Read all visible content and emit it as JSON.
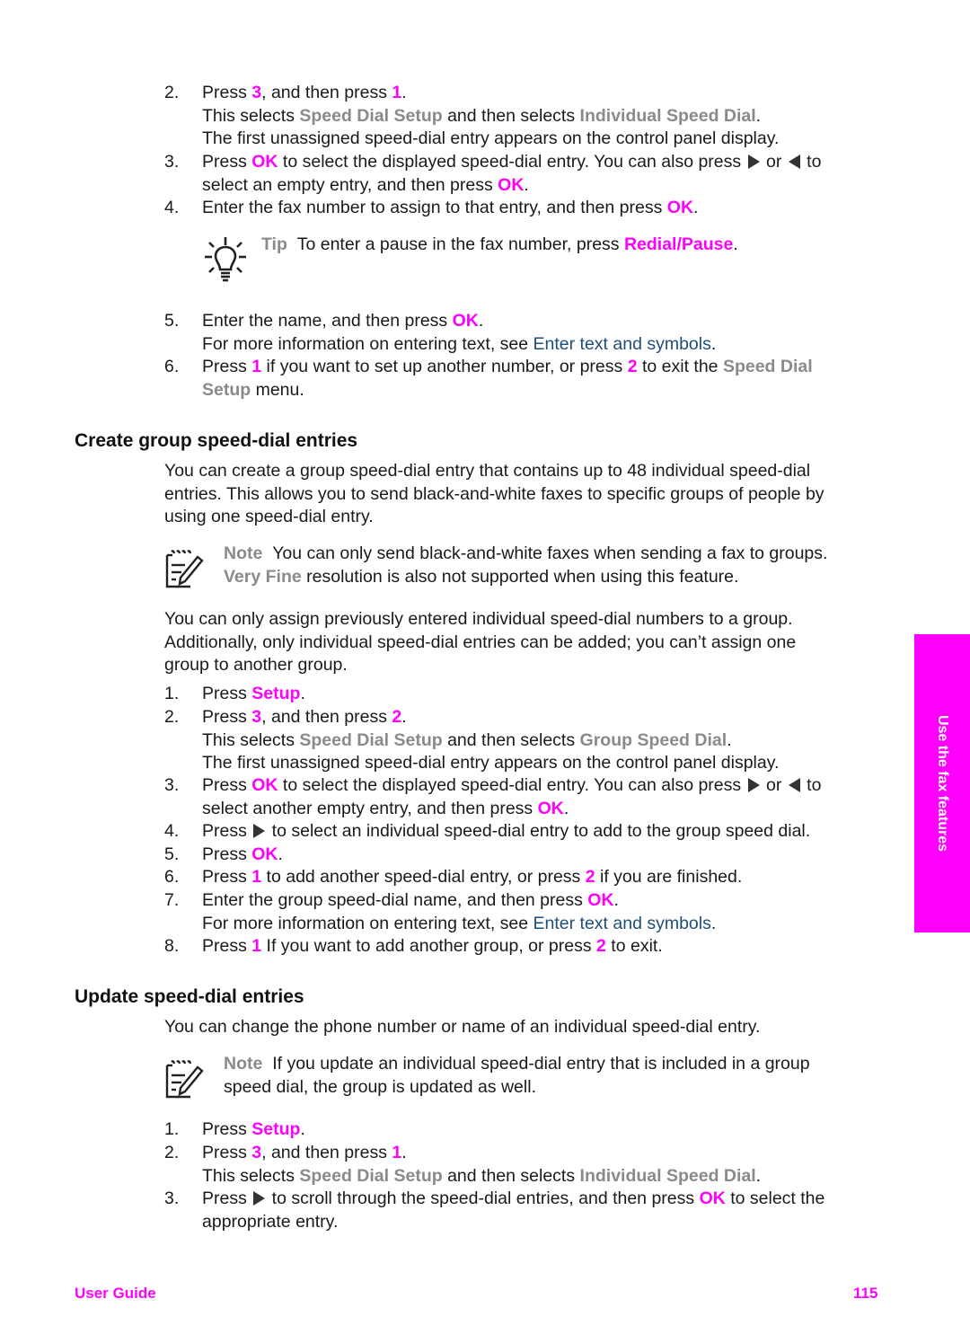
{
  "section1_steps": {
    "s2": {
      "num": "2.",
      "t1": "Press ",
      "k1": "3",
      "t2": ", and then press ",
      "k2": "1",
      "t3": ".",
      "l2a": "This selects ",
      "m1": "Speed Dial Setup",
      "l2b": " and then selects ",
      "m2": "Individual Speed Dial",
      "l2c": ".",
      "l3": "The first unassigned speed-dial entry appears on the control panel display."
    },
    "s3": {
      "num": "3.",
      "t1": "Press ",
      "k1": "OK",
      "t2": " to select the displayed speed-dial entry. You can also press ",
      "t3": " or ",
      "t4": " to",
      "l2a": "select an empty entry, and then press ",
      "k2": "OK",
      "l2b": "."
    },
    "s4": {
      "num": "4.",
      "t1": "Enter the fax number to assign to that entry, and then press ",
      "k1": "OK",
      "t2": "."
    },
    "tip": {
      "label": "Tip",
      "text": "To enter a pause in the fax number, press ",
      "key": "Redial/Pause",
      "end": "."
    },
    "s5": {
      "num": "5.",
      "t1": "Enter the name, and then press ",
      "k1": "OK",
      "t2": ".",
      "l2a": "For more information on entering text, see ",
      "link": "Enter text and symbols",
      "l2b": "."
    },
    "s6": {
      "num": "6.",
      "t1": "Press ",
      "k1": "1",
      "t2": " if you want to set up another number, or press ",
      "k2": "2",
      "t3": " to exit the ",
      "m1": "Speed Dial",
      "m2": "Setup",
      "l2b": " menu."
    }
  },
  "section2": {
    "heading": "Create group speed-dial entries",
    "intro": [
      "You can create a group speed-dial entry that contains up to 48 individual speed-dial",
      "entries. This allows you to send black-and-white faxes to specific groups of people by",
      "using one speed-dial entry."
    ],
    "note": {
      "label": "Note",
      "l1": "You can only send black-and-white faxes when sending a fax to groups.",
      "m1": "Very Fine",
      "l2": " resolution is also not supported when using this feature."
    },
    "para2": [
      "You can only assign previously entered individual speed-dial numbers to a group.",
      "Additionally, only individual speed-dial entries can be added; you can’t assign one",
      "group to another group."
    ],
    "s1": {
      "num": "1.",
      "t1": "Press ",
      "k1": "Setup",
      "t2": "."
    },
    "s2": {
      "num": "2.",
      "t1": "Press ",
      "k1": "3",
      "t2": ", and then press ",
      "k2": "2",
      "t3": ".",
      "l2a": "This selects ",
      "m1": "Speed Dial Setup",
      "l2b": " and then selects ",
      "m2": "Group Speed Dial",
      "l2c": ".",
      "l3": "The first unassigned speed-dial entry appears on the control panel display."
    },
    "s3": {
      "num": "3.",
      "t1": "Press ",
      "k1": "OK",
      "t2": " to select the displayed speed-dial entry. You can also press ",
      "t3": " or ",
      "t4": " to",
      "l2a": "select another empty entry, and then press ",
      "k2": "OK",
      "l2b": "."
    },
    "s4": {
      "num": "4.",
      "t1": "Press ",
      "t2": " to select an individual speed-dial entry to add to the group speed dial."
    },
    "s5": {
      "num": "5.",
      "t1": "Press ",
      "k1": "OK",
      "t2": "."
    },
    "s6": {
      "num": "6.",
      "t1": "Press ",
      "k1": "1",
      "t2": " to add another speed-dial entry, or press ",
      "k2": "2",
      "t3": " if you are finished."
    },
    "s7": {
      "num": "7.",
      "t1": "Enter the group speed-dial name, and then press ",
      "k1": "OK",
      "t2": ".",
      "l2a": "For more information on entering text, see ",
      "link": "Enter text and symbols",
      "l2b": "."
    },
    "s8": {
      "num": "8.",
      "t1": "Press ",
      "k1": "1",
      "t2": " If you want to add another group, or press ",
      "k2": "2",
      "t3": " to exit."
    }
  },
  "section3": {
    "heading": "Update speed-dial entries",
    "intro": "You can change the phone number or name of an individual speed-dial entry.",
    "note": {
      "label": "Note",
      "l1": "If you update an individual speed-dial entry that is included in a group",
      "l2": "speed dial, the group is updated as well."
    },
    "s1": {
      "num": "1.",
      "t1": "Press ",
      "k1": "Setup",
      "t2": "."
    },
    "s2": {
      "num": "2.",
      "t1": "Press ",
      "k1": "3",
      "t2": ", and then press ",
      "k2": "1",
      "t3": ".",
      "l2a": "This selects ",
      "m1": "Speed Dial Setup",
      "l2b": " and then selects ",
      "m2": "Individual Speed Dial",
      "l2c": "."
    },
    "s3": {
      "num": "3.",
      "t1": "Press ",
      "t2": " to scroll through the speed-dial entries, and then press ",
      "k1": "OK",
      "t3": " to select the",
      "l2": "appropriate entry."
    }
  },
  "side_tab": {
    "label": "Use the fax features",
    "color": "#ff00ff"
  },
  "footer": {
    "left": "User Guide",
    "page": "115"
  },
  "colors": {
    "key": "#ff00ff",
    "menu": "#8a8a8a",
    "link": "#1f4e79"
  }
}
